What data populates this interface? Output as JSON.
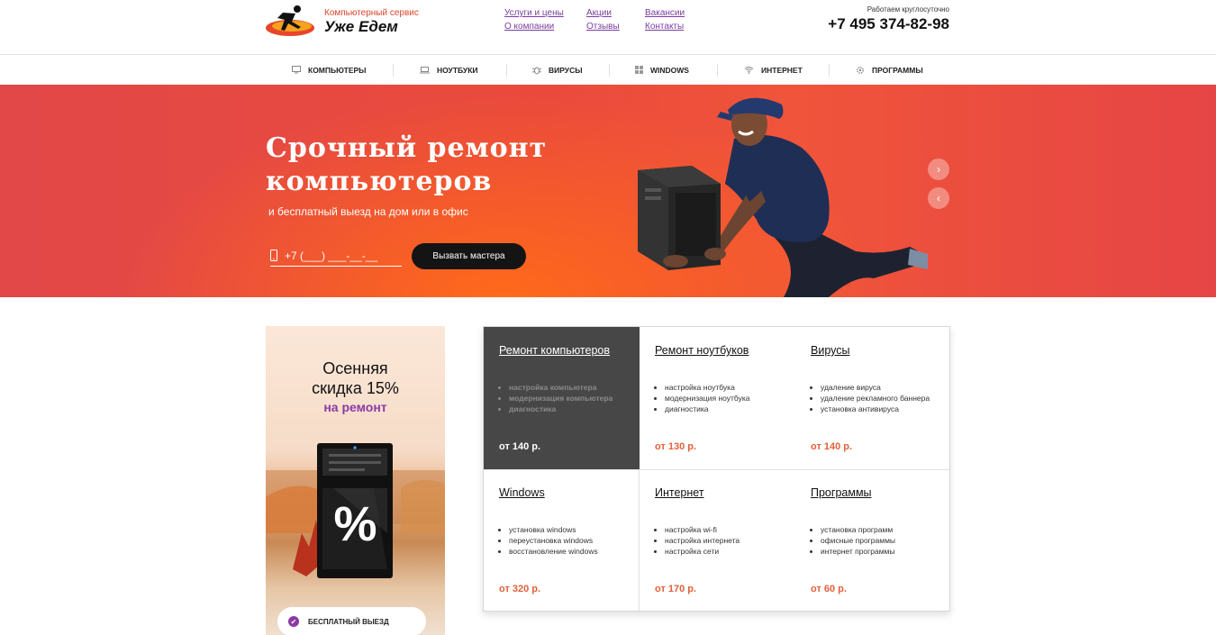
{
  "header": {
    "logo_subtitle": "Компьютерный сервис",
    "logo_title": "Уже Едем",
    "links": [
      "Услуги и цены",
      "Акции",
      "Вакансии",
      "О компании",
      "Отзывы",
      "Контакты"
    ],
    "hours": "Работаем круглосуточно",
    "phone": "+7 495 374-82-98"
  },
  "nav": {
    "items": [
      {
        "label": "КОМПЬЮТЕРЫ",
        "icon": "monitor-icon"
      },
      {
        "label": "НОУТБУКИ",
        "icon": "laptop-icon"
      },
      {
        "label": "ВИРУСЫ",
        "icon": "bug-icon"
      },
      {
        "label": "WINDOWS",
        "icon": "windows-icon"
      },
      {
        "label": "ИНТЕРНЕТ",
        "icon": "wifi-icon"
      },
      {
        "label": "ПРОГРАММЫ",
        "icon": "gear-icon"
      }
    ]
  },
  "hero": {
    "title_line1": "Срочный ремонт",
    "title_line2": "компьютеров",
    "subtitle": "и бесплатный выезд на дом или в офис",
    "phone_placeholder": "+7 (___) ___-__-__",
    "call_button": "Вызвать мастера",
    "slider_next": "›",
    "slider_prev": "‹"
  },
  "promo": {
    "title_line1": "Осенняя",
    "title_line2": "скидка 15%",
    "accent": "на ремонт",
    "badge_symbol": "%",
    "badge": "БЕСПЛАТНЫЙ ВЫЕЗД"
  },
  "services": [
    {
      "title": "Ремонт компьютеров",
      "items": [
        "настройка компьютера",
        "модернизация компьютера",
        "диагностика"
      ],
      "price": "от 140 р.",
      "active": true
    },
    {
      "title": "Ремонт ноутбуков",
      "items": [
        "настройка ноутбука",
        "модернизация ноутбука",
        "диагностика"
      ],
      "price": "от 130 р."
    },
    {
      "title": "Вирусы",
      "items": [
        "удаление вируса",
        "удаление рекламного баннера",
        "установка антивируса"
      ],
      "price": "от 140 р."
    },
    {
      "title": "Windows",
      "items": [
        "установка windows",
        "переустановка windows",
        "восстановление windows"
      ],
      "price": "от 320 р."
    },
    {
      "title": "Интернет",
      "items": [
        "настройка wi-fi",
        "настройка интернета",
        "настройка сети"
      ],
      "price": "от 170 р."
    },
    {
      "title": "Программы",
      "items": [
        "установка программ",
        "офисные программы",
        "интернет программы"
      ],
      "price": "от 60 р."
    }
  ],
  "colors": {
    "hero_red": "#e64545",
    "hero_orange": "#ff6a1a",
    "accent_purple": "#8b3aa5",
    "price_orange": "#e0613a",
    "active_tile": "#474747"
  }
}
